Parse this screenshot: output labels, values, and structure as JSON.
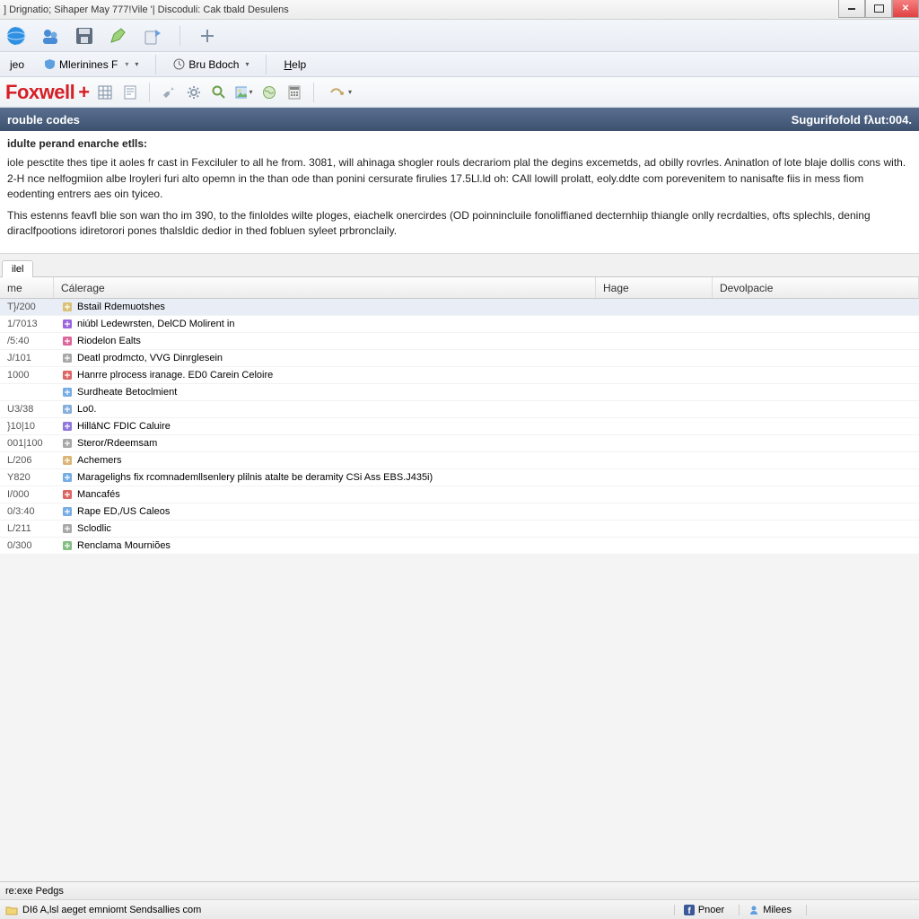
{
  "titlebar": {
    "text": "] Drignatio; Sihaper May 777!Vile '| Discoduli: Cak tbald Desulens"
  },
  "menubar": {
    "item1": "jeo",
    "item2": "Mlerinines F",
    "item3": "Bru Bdoch",
    "item4": "Help"
  },
  "logo": {
    "text": "Foxwell",
    "plus": "+"
  },
  "header": {
    "left": "rouble codes",
    "right": "Sugurifofold fλut:004."
  },
  "content": {
    "subhead": "idulte perand enarche etlls:",
    "para1": "iole pesctite thes tipe it aoles fr cast in Fexciluler to all he from. 3081, will ahinaga shogler rouls decrariom plal the degins excemetds, ad obilly rovrles. Aninatlon of lote blaje dollis cons with. 2-H nce nelfogmiion albe lroyleri furi alto opemn in the than ode than ponini cersurate firulies 17.5Ll.ld oh: CAll lowill prolatt, eoly.ddte com porevenitem to nanisafte fiis in mess fiom eodenting entrers aes oin tyiceo.",
    "para2": "This estenns feavfl blie son wan tho im 390, to the finloldes wilte ploges, eiachelk onercirdes (OD poinnincluile fonoliffianed decternhiip thiangle onlly recrdalties, ofts splechls, dening diraclfpootions idiretorori pones thalsldic dedior in thed fobluen syleet prbronclaily."
  },
  "tab": {
    "label": "ilel"
  },
  "columns": {
    "me": "me",
    "cal": "Cálerage",
    "hage": "Hage",
    "dev": "Devolpacie"
  },
  "rows": [
    {
      "me": "T}/200",
      "cal": "Bstail Rdеmuotshes",
      "sel": true
    },
    {
      "me": "1/7013",
      "cal": "niúbl Ledewrsten, DelCD Molirent in"
    },
    {
      "me": "/5:40",
      "cal": "Riodelon Ealts"
    },
    {
      "me": "J/101",
      "cal": "Deatl prodmcto, VVG Dinrglesein"
    },
    {
      "me": "1000",
      "cal": "Hanrre plrocess iranage. ED0 Carein Celoire"
    },
    {
      "me": "",
      "cal": "Surdheate Betoclmient"
    },
    {
      "me": "U3/38",
      "cal": "Lo0."
    },
    {
      "me": "}10|10",
      "cal": "HilláNC FDIC Caluire"
    },
    {
      "me": "001|100",
      "cal": "Steror/Rdeemsam"
    },
    {
      "me": "L/206",
      "cal": "Achemers"
    },
    {
      "me": "Y820",
      "cal": "Maragelighs fix rcomnademllsenlery plilnis atalte be deramity CSi Ass EBS.J435i)"
    },
    {
      "me": "I/000",
      "cal": "Mancafés"
    },
    {
      "me": "0/3:40",
      "cal": "Rape ED,/US Caleos"
    },
    {
      "me": "L/211",
      "cal": "Sclodlic"
    },
    {
      "me": "0/300",
      "cal": "Renclama Mourniões"
    }
  ],
  "status": {
    "top": "re:exe Pedgs",
    "bottom_left": "DI6 A,lsl aeget emniomt Sendsallies com",
    "pill1": "Pnoer",
    "pill2": "Milees"
  },
  "icons": {
    "t1_a": "globe",
    "t1_b": "users",
    "t1_c": "save",
    "t1_d": "pen",
    "t1_e": "share",
    "t1_f": "plus",
    "t3": [
      "grid",
      "doc",
      "wrench",
      "gear",
      "zoom",
      "image",
      "drop",
      "globe2",
      "calc",
      "split",
      "arrow"
    ]
  }
}
